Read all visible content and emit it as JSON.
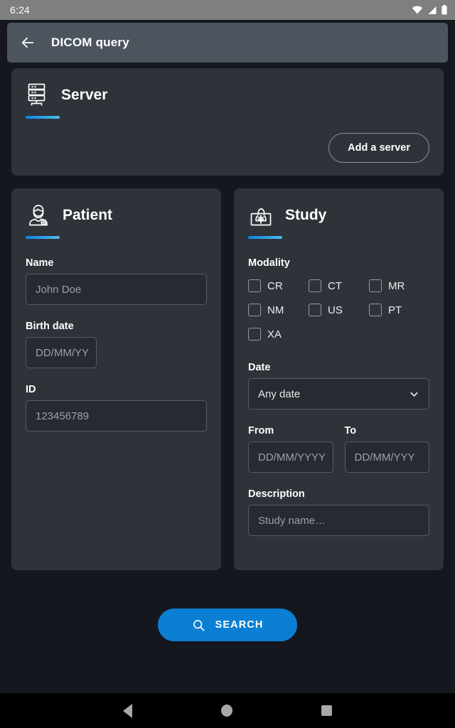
{
  "statusbar": {
    "clock": "6:24",
    "icons": [
      "wifi-icon",
      "cellular-signal-icon",
      "battery-icon"
    ]
  },
  "appbar": {
    "back_icon": "arrow-left-icon",
    "title": "DICOM query"
  },
  "server": {
    "icon": "server-rack-icon",
    "title": "Server",
    "add_button_label": "Add a server"
  },
  "patient": {
    "icon": "patient-icon",
    "title": "Patient",
    "fields": [
      {
        "label": "Name",
        "value": "",
        "placeholder": "John Doe"
      },
      {
        "label": "Birth date",
        "value": "",
        "placeholder": "DD/MM/YY"
      },
      {
        "label": "ID",
        "value": "",
        "placeholder": "123456789"
      }
    ]
  },
  "study": {
    "icon": "chest-xray-icon",
    "title": "Study",
    "modality_label": "Modality",
    "modalities": [
      {
        "label": "CR",
        "checked": false
      },
      {
        "label": "CT",
        "checked": false
      },
      {
        "label": "MR",
        "checked": false
      },
      {
        "label": "NM",
        "checked": false
      },
      {
        "label": "US",
        "checked": false
      },
      {
        "label": "PT",
        "checked": false
      },
      {
        "label": "XA",
        "checked": false
      }
    ],
    "date_label": "Date",
    "date_selected": "Any date",
    "date_options": [
      "Any date"
    ],
    "date_chevron_icon": "chevron-down-icon",
    "from_label": "From",
    "from_placeholder": "DD/MM/YYYY",
    "to_label": "To",
    "to_placeholder": "DD/MM/YYY",
    "description_label": "Description",
    "description_placeholder": "Study name…"
  },
  "search": {
    "icon": "search-icon",
    "label": "SEARCH"
  },
  "navbar": {
    "back_icon": "nav-back-triangle-icon",
    "home_icon": "nav-home-circle-icon",
    "recents_icon": "nav-recents-square-icon"
  },
  "colors": {
    "accent_blue": "#0b7fd4",
    "accent_blue_light": "#51bbe9",
    "background": "#14181e",
    "card": "#2e3339",
    "appbar": "#4c545e",
    "statusbar": "#7f7f7f"
  }
}
